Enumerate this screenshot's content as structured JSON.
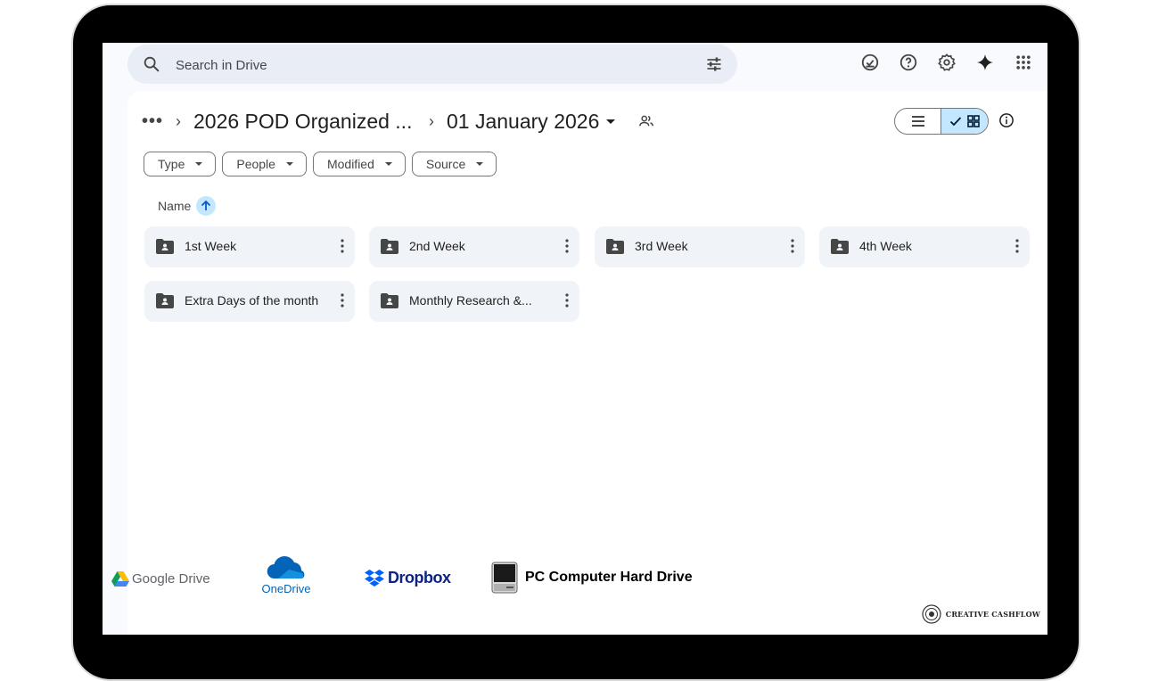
{
  "search": {
    "placeholder": "Search in Drive"
  },
  "header_icons": [
    "offline-status-icon",
    "help-icon",
    "settings-icon",
    "gemini-sparkle-icon",
    "apps-grid-icon"
  ],
  "breadcrumb": {
    "more": "•••",
    "parent": "2026 POD Organized ...",
    "current": "01 January 2026"
  },
  "view_toggle": {
    "selected": "grid"
  },
  "filters": [
    {
      "label": "Type"
    },
    {
      "label": "People"
    },
    {
      "label": "Modified"
    },
    {
      "label": "Source"
    }
  ],
  "sort": {
    "label": "Name",
    "direction": "ascending"
  },
  "folders": [
    {
      "name": "1st Week"
    },
    {
      "name": "2nd Week"
    },
    {
      "name": "3rd Week"
    },
    {
      "name": "4th Week"
    },
    {
      "name": "Extra Days of the month"
    },
    {
      "name": "Monthly Research &..."
    }
  ],
  "logos": {
    "google_drive": "Google Drive",
    "onedrive": "OneDrive",
    "dropbox": "Dropbox",
    "hard_drive": "PC Computer Hard Drive"
  },
  "brand": "CREATIVE CASHFLOW",
  "colors": {
    "accent": "#c2e7ff",
    "search_bg": "#e9eef6",
    "folder_bg": "#f0f4f9",
    "onedrive_blue": "#0364b8",
    "dropbox_blue": "#0061fe"
  }
}
